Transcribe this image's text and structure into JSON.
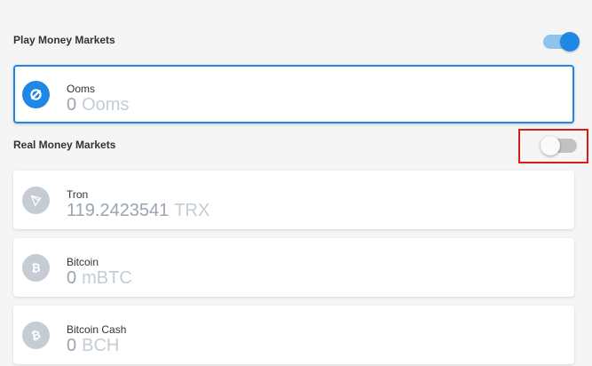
{
  "play_money": {
    "title": "Play Money Markets",
    "toggle_on": true,
    "markets": [
      {
        "name": "Ooms",
        "amount": "0",
        "unit": "Ooms",
        "icon": "ooms-icon",
        "color": "#1e88e5",
        "selected": true
      }
    ]
  },
  "real_money": {
    "title": "Real Money Markets",
    "toggle_on": false,
    "markets": [
      {
        "name": "Tron",
        "amount": "119.2423541",
        "unit": "TRX",
        "icon": "tron-icon",
        "color": "#c5ccd3"
      },
      {
        "name": "Bitcoin",
        "amount": "0",
        "unit": "mBTC",
        "icon": "bitcoin-icon",
        "color": "#c5ccd3"
      },
      {
        "name": "Bitcoin Cash",
        "amount": "0",
        "unit": "BCH",
        "icon": "bitcoin-cash-icon",
        "color": "#c5ccd3"
      }
    ]
  },
  "colors": {
    "accent": "#1e88e5",
    "highlight": "#d81b1b",
    "muted_icon": "#c5ccd3"
  }
}
